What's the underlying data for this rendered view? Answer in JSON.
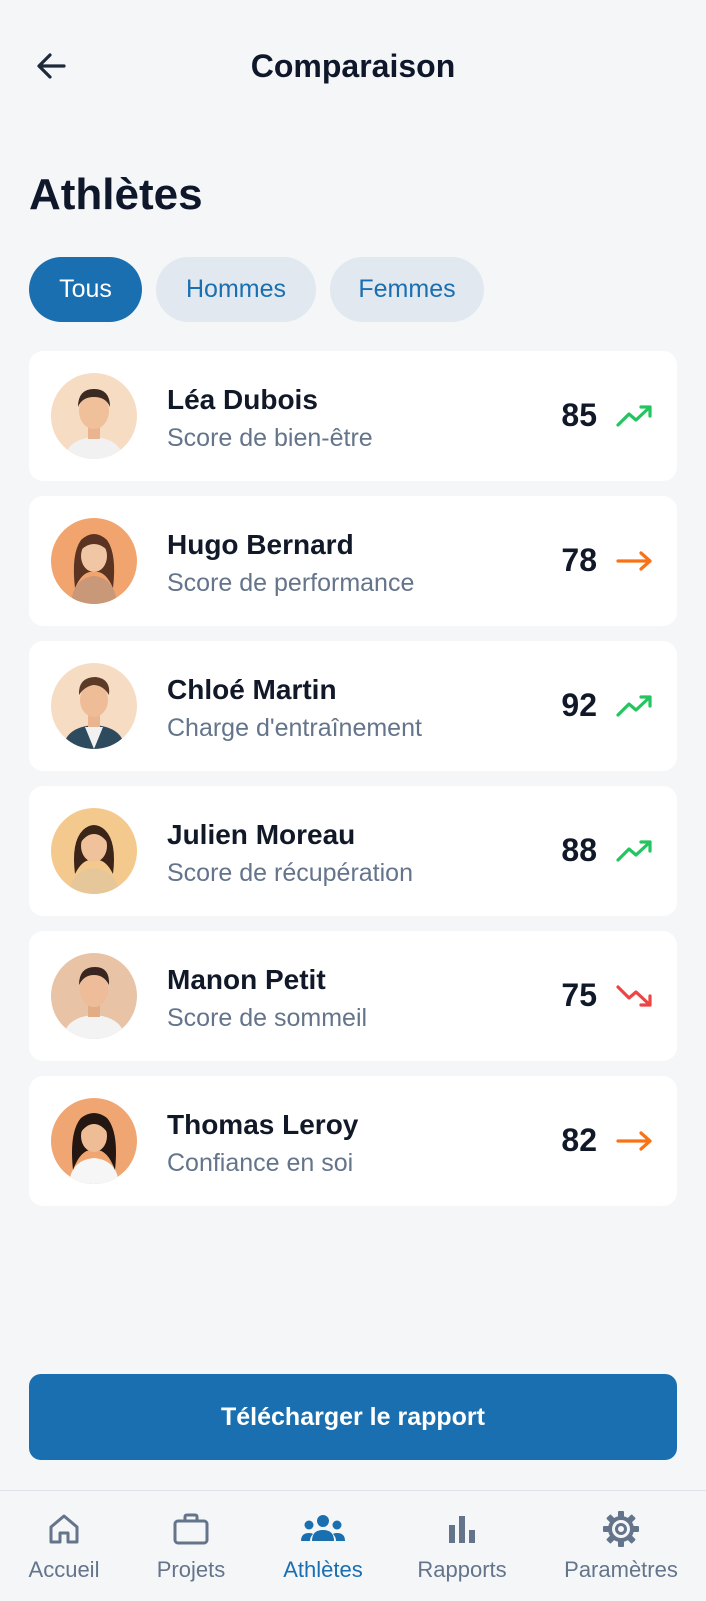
{
  "header": {
    "title": "Comparaison"
  },
  "section": {
    "title": "Athlètes"
  },
  "filters": [
    {
      "label": "Tous",
      "active": true
    },
    {
      "label": "Hommes",
      "active": false
    },
    {
      "label": "Femmes",
      "active": false
    }
  ],
  "athletes": [
    {
      "name": "Léa Dubois",
      "metric": "Score de bien-être",
      "score": "85",
      "trend": "up"
    },
    {
      "name": "Hugo Bernard",
      "metric": "Score de performance",
      "score": "78",
      "trend": "flat"
    },
    {
      "name": "Chloé Martin",
      "metric": "Charge d'entraînement",
      "score": "92",
      "trend": "up"
    },
    {
      "name": "Julien Moreau",
      "metric": "Score de récupération",
      "score": "88",
      "trend": "up"
    },
    {
      "name": "Manon Petit",
      "metric": "Score de sommeil",
      "score": "75",
      "trend": "down"
    },
    {
      "name": "Thomas Leroy",
      "metric": "Confiance en soi",
      "score": "82",
      "trend": "flat"
    }
  ],
  "cta": {
    "label": "Télécharger le rapport"
  },
  "tabs": [
    {
      "label": "Accueil",
      "icon": "home-icon",
      "active": false
    },
    {
      "label": "Projets",
      "icon": "briefcase-icon",
      "active": false
    },
    {
      "label": "Athlètes",
      "icon": "team-icon",
      "active": true
    },
    {
      "label": "Rapports",
      "icon": "bar-chart-icon",
      "active": false
    },
    {
      "label": "Paramètres",
      "icon": "gear-icon",
      "active": false
    }
  ],
  "colors": {
    "primary": "#1a6fb0",
    "trend_up": "#22c55e",
    "trend_flat": "#f97316",
    "trend_down": "#ef4444"
  }
}
